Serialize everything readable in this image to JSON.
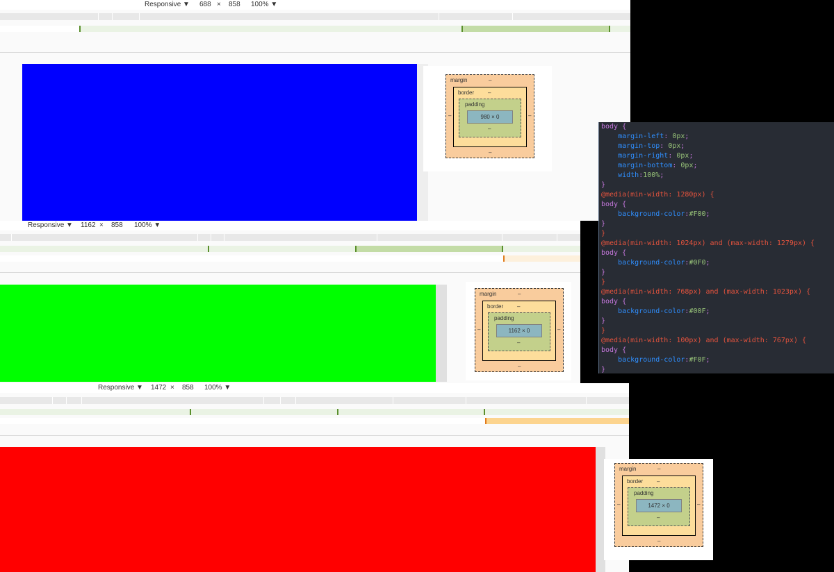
{
  "panels": [
    {
      "mode": "Responsive",
      "width": "688",
      "sep": "×",
      "height": "858",
      "zoom": "100%",
      "content": "980 × 0",
      "bg": "#0000FF"
    },
    {
      "mode": "Responsive",
      "width": "1162",
      "sep": "×",
      "height": "858",
      "zoom": "100%",
      "content": "1162 × 0",
      "bg": "#00FF00"
    },
    {
      "mode": "Responsive",
      "width": "1472",
      "sep": "×",
      "height": "858",
      "zoom": "100%",
      "content": "1472 × 0",
      "bg": "#FF0000"
    }
  ],
  "boxmodel": {
    "margin": "margin",
    "border": "border",
    "padding": "padding",
    "dash": "–"
  },
  "icons": {
    "dropdown": "▼"
  },
  "code_lines": [
    [
      {
        "c": "sel",
        "t": "body"
      },
      {
        "c": "punc",
        "t": " {"
      }
    ],
    [
      {
        "c": "prop",
        "t": "    margin-left"
      },
      {
        "c": "punc",
        "t": ": "
      },
      {
        "c": "num",
        "t": "0px"
      },
      {
        "c": "punc",
        "t": ";"
      }
    ],
    [
      {
        "c": "prop",
        "t": "    margin-top"
      },
      {
        "c": "punc",
        "t": ": "
      },
      {
        "c": "num",
        "t": "0px"
      },
      {
        "c": "punc",
        "t": ";"
      }
    ],
    [
      {
        "c": "prop",
        "t": "    margin-right"
      },
      {
        "c": "punc",
        "t": ": "
      },
      {
        "c": "num",
        "t": "0px"
      },
      {
        "c": "punc",
        "t": ";"
      }
    ],
    [
      {
        "c": "prop",
        "t": "    margin-bottom"
      },
      {
        "c": "punc",
        "t": ": "
      },
      {
        "c": "num",
        "t": "0px"
      },
      {
        "c": "punc",
        "t": ";"
      }
    ],
    [
      {
        "c": "prop",
        "t": "    width"
      },
      {
        "c": "punc",
        "t": ":"
      },
      {
        "c": "num",
        "t": "100%"
      },
      {
        "c": "punc",
        "t": ";"
      }
    ],
    [
      {
        "c": "punc",
        "t": "}"
      }
    ],
    [
      {
        "c": "media",
        "t": "@media(min-width: 1280px) {"
      }
    ],
    [
      {
        "c": "sel",
        "t": "body"
      },
      {
        "c": "punc",
        "t": " {"
      }
    ],
    [
      {
        "c": "prop",
        "t": "    background-color"
      },
      {
        "c": "punc",
        "t": ":"
      },
      {
        "c": "num",
        "t": "#F00"
      },
      {
        "c": "punc",
        "t": ";"
      }
    ],
    [
      {
        "c": "punc",
        "t": "}"
      }
    ],
    [
      {
        "c": "brace",
        "t": "}"
      }
    ],
    [
      {
        "c": "media",
        "t": "@media(min-width: 1024px) and (max-width: 1279px) {"
      }
    ],
    [
      {
        "c": "sel",
        "t": "body"
      },
      {
        "c": "punc",
        "t": " {"
      }
    ],
    [
      {
        "c": "prop",
        "t": "    background-color"
      },
      {
        "c": "punc",
        "t": ":"
      },
      {
        "c": "num",
        "t": "#0F0"
      },
      {
        "c": "punc",
        "t": ";"
      }
    ],
    [
      {
        "c": "punc",
        "t": "}"
      }
    ],
    [
      {
        "c": "brace",
        "t": "}"
      }
    ],
    [
      {
        "c": "media",
        "t": "@media(min-width: 768px) and (max-width: 1023px) {"
      }
    ],
    [
      {
        "c": "sel",
        "t": "body"
      },
      {
        "c": "punc",
        "t": " {"
      }
    ],
    [
      {
        "c": "prop",
        "t": "    background-color"
      },
      {
        "c": "punc",
        "t": ":"
      },
      {
        "c": "num",
        "t": "#00F"
      },
      {
        "c": "punc",
        "t": ";"
      }
    ],
    [
      {
        "c": "punc",
        "t": "}"
      }
    ],
    [
      {
        "c": "brace",
        "t": "}"
      }
    ],
    [
      {
        "c": "media",
        "t": "@media(min-width: 100px) and (max-width: 767px) {"
      }
    ],
    [
      {
        "c": "sel",
        "t": "body"
      },
      {
        "c": "punc",
        "t": " {"
      }
    ],
    [
      {
        "c": "prop",
        "t": "    background-color"
      },
      {
        "c": "punc",
        "t": ":"
      },
      {
        "c": "num",
        "t": "#F0F"
      },
      {
        "c": "punc",
        "t": ";"
      }
    ],
    [
      {
        "c": "punc",
        "t": "}"
      }
    ]
  ]
}
